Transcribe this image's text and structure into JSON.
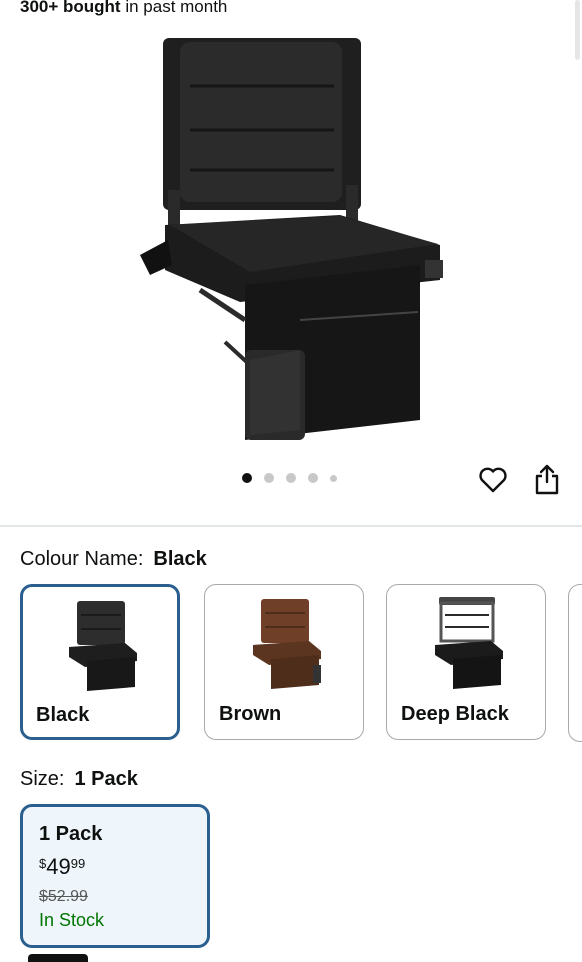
{
  "header": {
    "bought_count": "300+ bought",
    "bought_suffix": " in past month"
  },
  "gallery": {
    "dots": 5,
    "active_index": 0
  },
  "colour": {
    "label": "Colour Name:",
    "selected": "Black",
    "options": [
      {
        "name": "Black",
        "selected": true,
        "color": "#222222"
      },
      {
        "name": "Brown",
        "selected": false,
        "color": "#6b3f24"
      },
      {
        "name": "Deep Black",
        "selected": false,
        "color": "#1b1b1b"
      }
    ]
  },
  "size": {
    "label": "Size:",
    "selected": "1 Pack",
    "card": {
      "title": "1 Pack",
      "price_symbol": "$",
      "price_whole": "49",
      "price_cents": "99",
      "was": "$52.99",
      "stock": "In Stock"
    }
  },
  "colors": {
    "accent": "#2a5f8f",
    "in_stock": "#007600",
    "selected_bg": "#eef6fb"
  }
}
